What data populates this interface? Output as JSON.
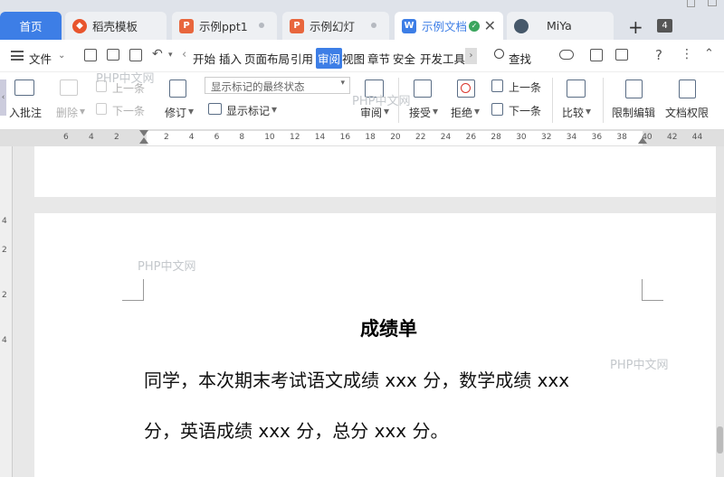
{
  "tabs": [
    {
      "label": "首页"
    },
    {
      "label": "稻壳模板"
    },
    {
      "label": "示例ppt1"
    },
    {
      "label": "示例幻灯"
    },
    {
      "label": "示例文档"
    },
    {
      "label": "MiYa"
    }
  ],
  "tab_count_badge": "4",
  "menu": {
    "file": "文件",
    "items": [
      "开始",
      "插入",
      "页面布局",
      "引用",
      "审阅",
      "视图",
      "章节",
      "安全",
      "开发工具"
    ],
    "active": "审阅",
    "search": "查找"
  },
  "ribbon": {
    "insert_comment": "入批注",
    "delete": "删除",
    "prev_top": "上一条",
    "next_top": "下一条",
    "revise": "修订",
    "markup_state": "显示标记的最终状态",
    "show_markup": "显示标记",
    "review": "审阅",
    "accept": "接受",
    "reject": "拒绝",
    "prev": "上一条",
    "next": "下一条",
    "compare": "比较",
    "restrict_edit": "限制编辑",
    "doc_permission": "文档权限"
  },
  "ruler": {
    "left_numbers": [
      "6",
      "4",
      "2"
    ],
    "right_numbers": [
      "2",
      "4",
      "6",
      "8",
      "10",
      "12",
      "14",
      "16",
      "18",
      "20",
      "22",
      "24",
      "26",
      "28",
      "30",
      "32",
      "34",
      "36",
      "38",
      "40",
      "42",
      "44"
    ],
    "vertical_numbers": [
      "4",
      "2",
      "2",
      "4"
    ]
  },
  "document": {
    "title": "成绩单",
    "line1": "同学，本次期末考试语文成绩 xxx 分，数学成绩 xxx",
    "line2": "分，英语成绩 xxx 分，总分 xxx 分。"
  },
  "watermark": "PHP中文网",
  "colors": {
    "accent": "#3d7ee6",
    "ppt": "#e8663d",
    "doc": "#3d7ee6"
  }
}
